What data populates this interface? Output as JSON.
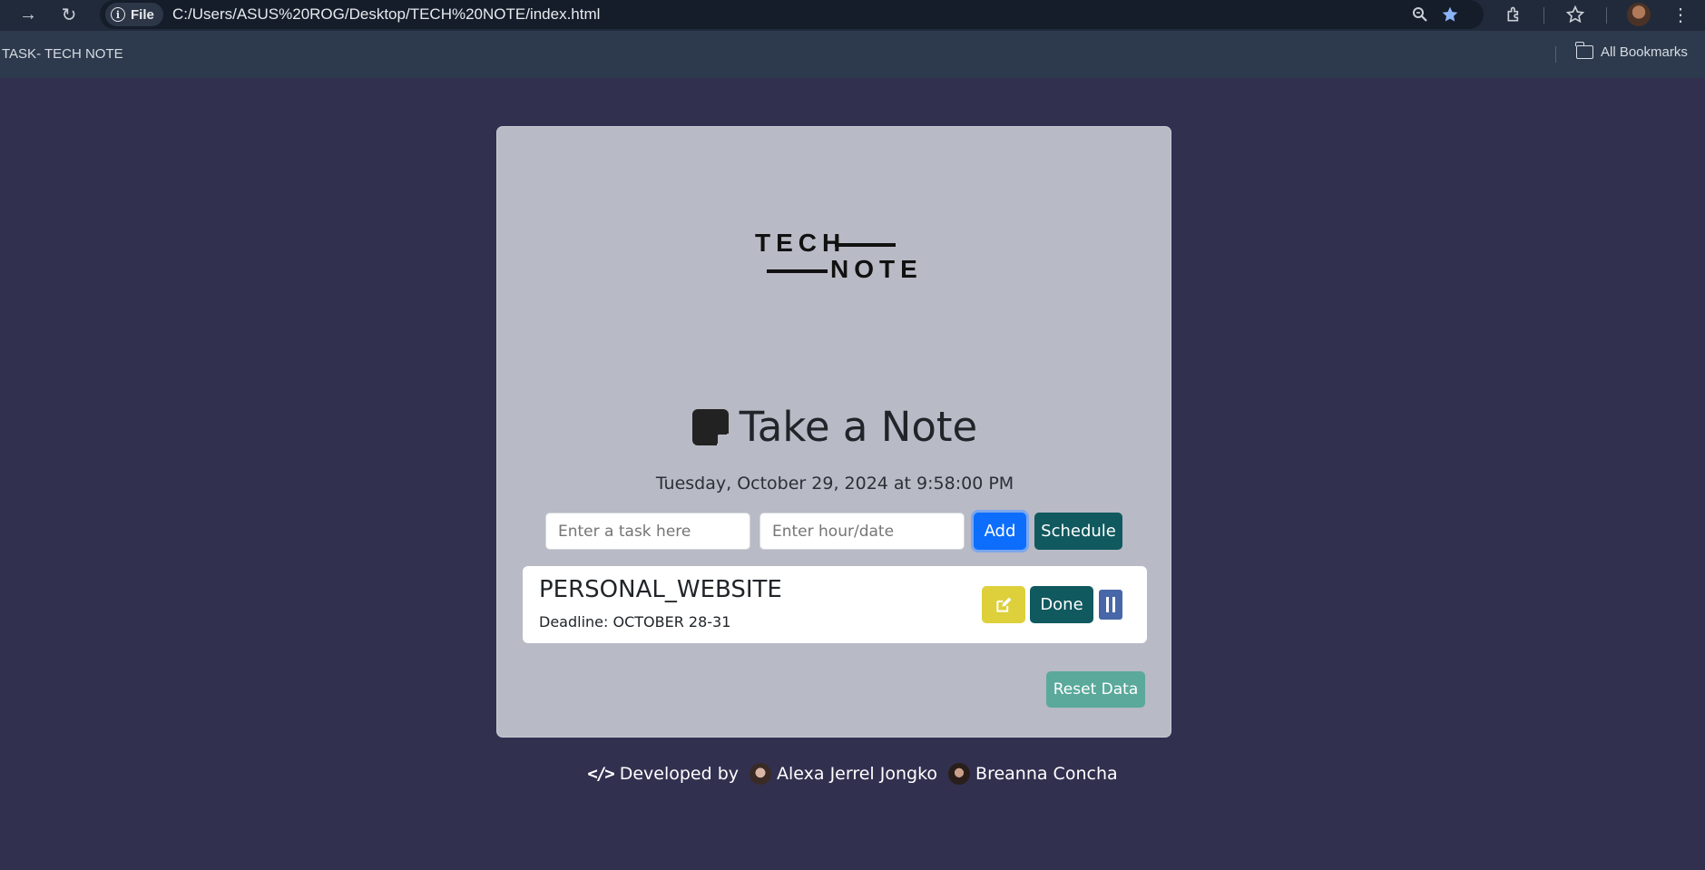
{
  "browser": {
    "url": "C:/Users/ASUS%20ROG/Desktop/TECH%20NOTE/index.html",
    "file_chip": "File",
    "bookmark_title": "TASK- TECH NOTE",
    "all_bookmarks": "All Bookmarks"
  },
  "logo": {
    "line1": "TECH",
    "line2": "NOTE"
  },
  "heading": {
    "title": "Take a Note"
  },
  "date_text": "Tuesday, October 29, 2024 at 9:58:00 PM",
  "form": {
    "task_placeholder": "Enter a task here",
    "date_placeholder": "Enter hour/date",
    "add_label": "Add",
    "schedule_label": "Schedule"
  },
  "tasks": [
    {
      "title": "PERSONAL_WEBSITE",
      "deadline": "Deadline: OCTOBER 28-31",
      "done_label": "Done"
    }
  ],
  "reset_label": "Reset Data",
  "footer": {
    "developed_by": "Developed by",
    "developers": [
      "Alexa Jerrel Jongko",
      "Breanna Concha"
    ]
  },
  "colors": {
    "page_bg": "#32304f",
    "card_bg": "#b8bac5",
    "add_button": "#0d6efd",
    "schedule_button": "#10595f",
    "edit_button": "#ddd03b",
    "pause_button": "#4767a8",
    "reset_button": "#5aa99b"
  }
}
